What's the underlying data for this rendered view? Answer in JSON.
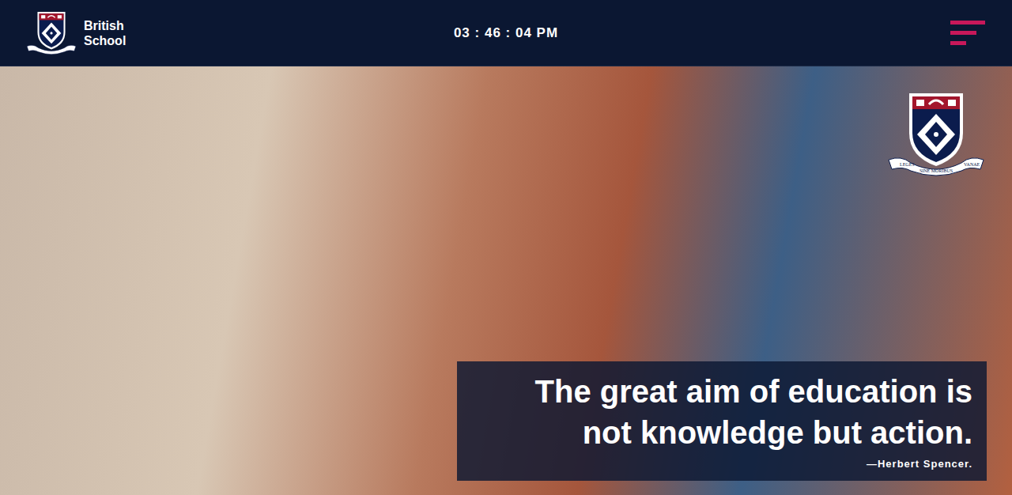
{
  "header": {
    "brand": [
      "British",
      "School"
    ],
    "clock": "03 : 46 : 04 PM"
  },
  "hero": {
    "crest_motto": [
      "LEGES",
      "SINE MORIBUS",
      "VANAE"
    ],
    "quote": {
      "lines": [
        "The great aim of education is",
        "not knowledge but action."
      ],
      "author": "—Herbert Spencer."
    }
  }
}
